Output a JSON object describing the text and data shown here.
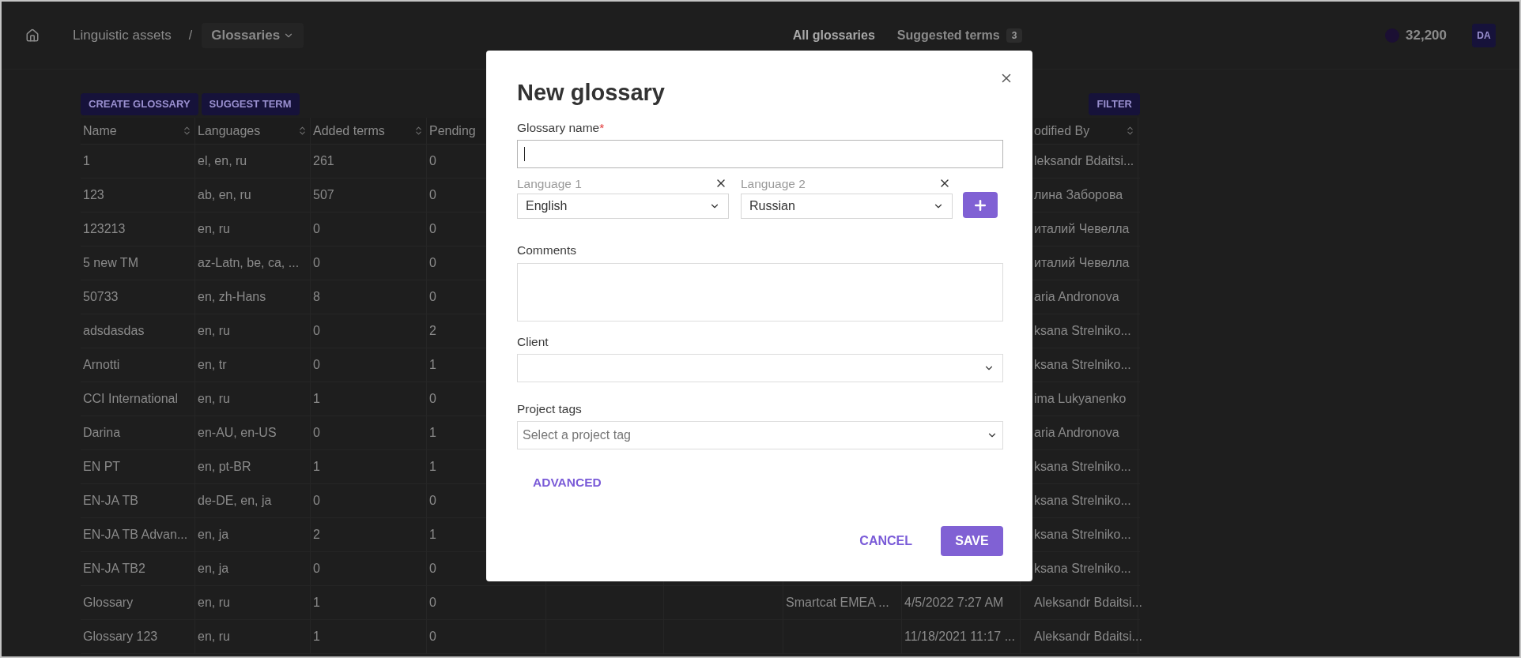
{
  "topbar": {
    "breadcrumbs": [
      {
        "label": "Linguistic assets"
      }
    ],
    "separator": "/",
    "current": "Glossaries",
    "tabs": [
      {
        "label": "All glossaries",
        "selected": true
      },
      {
        "label": "Suggested terms",
        "badge": "3",
        "selected": false
      }
    ],
    "balance": "32,200",
    "avatar": "DA"
  },
  "toolbar": {
    "buttons": [
      "CREATE GLOSSARY",
      "SUGGEST TERM"
    ],
    "filter": "FILTER"
  },
  "table": {
    "columns": [
      {
        "label": "Name",
        "sortable": true
      },
      {
        "label": "Languages",
        "sortable": true
      },
      {
        "label": "Added terms",
        "sortable": true
      },
      {
        "label": "Pending"
      },
      null,
      null,
      null,
      null,
      {
        "label": "odified By",
        "sortable": true
      }
    ],
    "rows": [
      {
        "cells": [
          "1",
          "el, en, ru",
          "261",
          "0",
          "",
          "",
          "",
          "",
          "leksandr Bdaitsi..."
        ]
      },
      {
        "cells": [
          "123",
          "ab, en, ru",
          "507",
          "0",
          "",
          "",
          "",
          "",
          "лина Заборова"
        ]
      },
      {
        "cells": [
          "123213",
          "en, ru",
          "0",
          "0",
          "",
          "",
          "",
          "",
          "италий Чевелла"
        ]
      },
      {
        "cells": [
          "5 new TM",
          "az-Latn, be, ca, ...",
          "0",
          "0",
          "",
          "",
          "",
          "",
          "италий Чевелла"
        ]
      },
      {
        "cells": [
          "50733",
          "en, zh-Hans",
          "8",
          "0",
          "",
          "",
          "",
          "",
          "aria Andronova"
        ]
      },
      {
        "cells": [
          "adsdasdas",
          "en, ru",
          "0",
          "2",
          "",
          "",
          "",
          "",
          "ksana Strelniko..."
        ]
      },
      {
        "cells": [
          "Arnotti",
          "en, tr",
          "0",
          "1",
          "",
          "",
          "",
          "",
          "ksana Strelniko..."
        ]
      },
      {
        "cells": [
          "CCI International",
          "en, ru",
          "1",
          "0",
          "",
          "",
          "",
          "",
          "ima Lukyanenko"
        ]
      },
      {
        "cells": [
          "Darina",
          "en-AU, en-US",
          "0",
          "1",
          "",
          "",
          "",
          "",
          "aria Andronova"
        ]
      },
      {
        "cells": [
          "EN PT",
          "en, pt-BR",
          "1",
          "1",
          "",
          "",
          "",
          "",
          "ksana Strelniko..."
        ]
      },
      {
        "cells": [
          "EN-JA TB",
          "de-DE, en, ja",
          "0",
          "0",
          "",
          "",
          "",
          "",
          "ksana Strelniko..."
        ]
      },
      {
        "cells": [
          "EN-JA TB Advan...",
          "en, ja",
          "2",
          "1",
          "",
          "",
          "",
          "",
          "ksana Strelniko..."
        ]
      },
      {
        "cells": [
          "EN-JA TB2",
          "en, ja",
          "0",
          "0",
          "",
          "",
          "",
          "",
          "ksana Strelniko..."
        ]
      },
      {
        "cells": [
          "Glossary",
          "en, ru",
          "1",
          "0",
          "",
          "",
          "Smartcat EMEA ...",
          "4/5/2022 7:27 AM",
          "Aleksandr Bdaitsi..."
        ]
      },
      {
        "cells": [
          "Glossary 123",
          "en, ru",
          "1",
          "0",
          "",
          "",
          "",
          "11/18/2021 11:17 ...",
          "Aleksandr Bdaitsi..."
        ]
      }
    ]
  },
  "dialog": {
    "title": "New glossary",
    "name_field": {
      "label": "Glossary name",
      "required_mark": "*",
      "focused": true
    },
    "languages": [
      {
        "label": "Language 1",
        "value": "English"
      },
      {
        "label": "Language 2",
        "value": "Russian"
      }
    ],
    "comments": {
      "label": "Comments"
    },
    "client": {
      "label": "Client"
    },
    "project_tags": {
      "label": "Project tags",
      "placeholder": "Select a project tag"
    },
    "advanced": "ADVANCED",
    "cancel": "CANCEL",
    "save": "SAVE"
  }
}
